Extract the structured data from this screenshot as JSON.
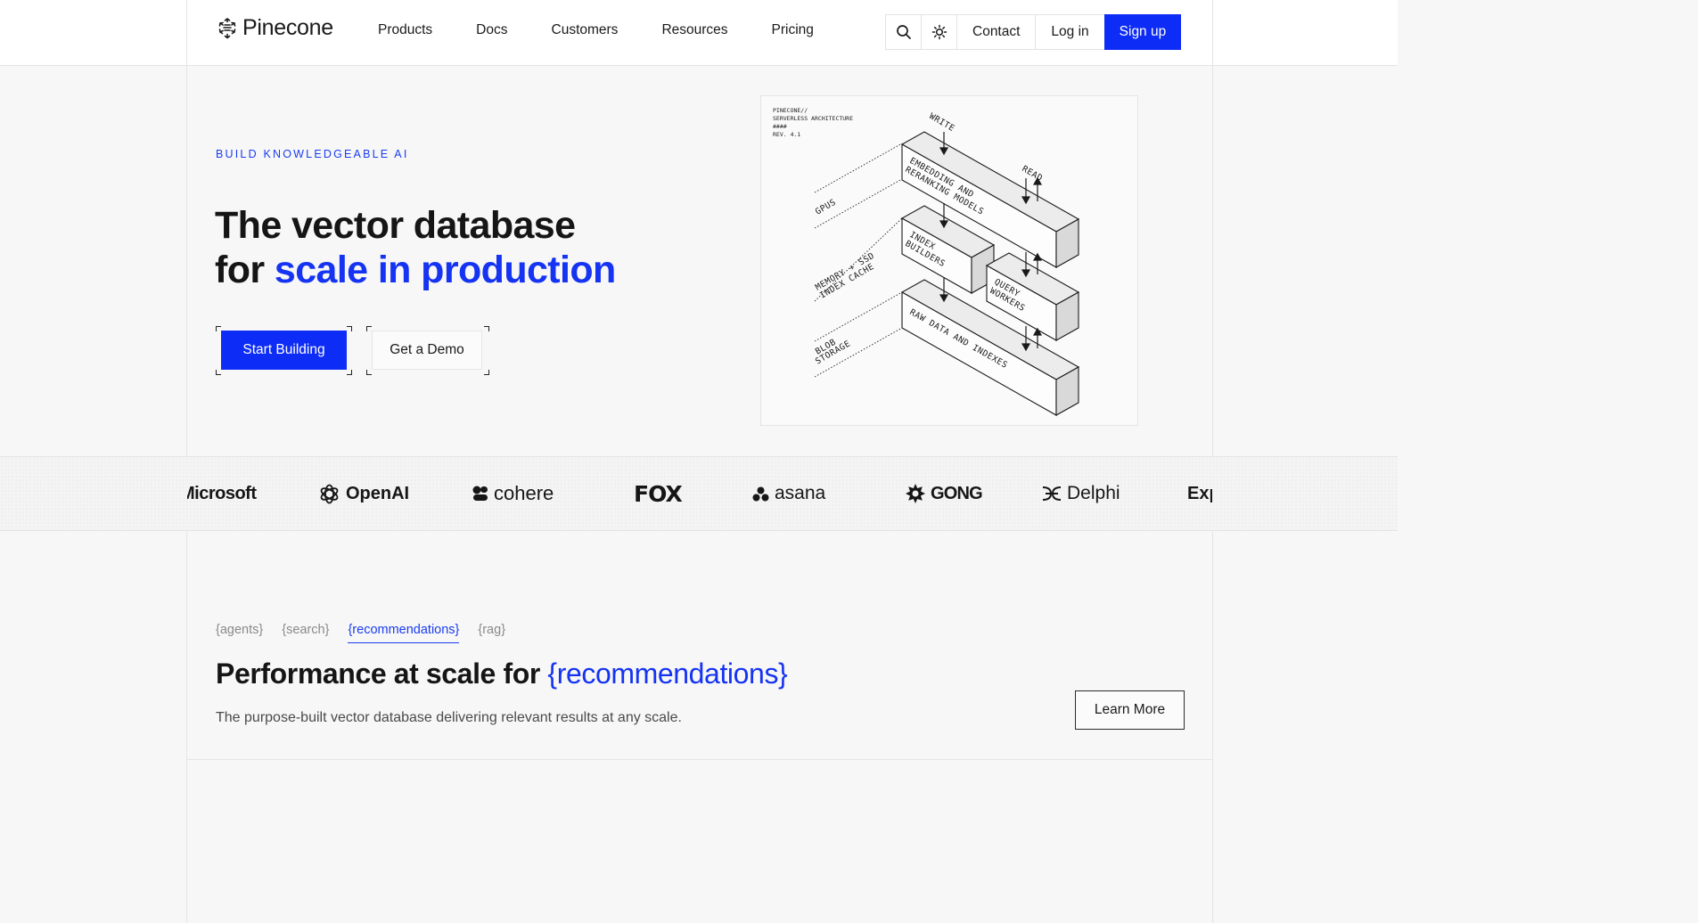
{
  "header": {
    "brand": "Pinecone",
    "nav": [
      {
        "label": "Products"
      },
      {
        "label": "Docs"
      },
      {
        "label": "Customers"
      },
      {
        "label": "Resources"
      },
      {
        "label": "Pricing"
      }
    ],
    "contact_label": "Contact",
    "login_label": "Log in",
    "signup_label": "Sign up"
  },
  "hero": {
    "eyebrow": "BUILD KNOWLEDGEABLE AI",
    "title_line1": "The vector database",
    "title_line2_prefix": "for ",
    "title_line2_accent": "scale in production",
    "start_label": "Start Building",
    "demo_label": "Get a Demo"
  },
  "diagram": {
    "header_lines": [
      "PINECONE//",
      "SERVERLESS ARCHITECTURE",
      "####",
      "REV. 4.1"
    ],
    "write": "WRITE",
    "read": "READ",
    "gpus": "GPUS",
    "memory_line1": "MEMORY + SSD",
    "memory_line2": "INDEX CACHE",
    "blob_line1": "BLOB",
    "blob_line2": "STORAGE",
    "embed_line1": "EMBEDDING AND",
    "embed_line2": "RERANKING MODELS",
    "index_line1": "INDEX",
    "index_line2": "BUILDERS",
    "query_line1": "QUERY",
    "query_line2": "WORKERS",
    "raw": "RAW DATA AND INDEXES"
  },
  "logos": [
    {
      "name": "Microsoft",
      "text": "Microsoft"
    },
    {
      "name": "OpenAI",
      "text": "OpenAI"
    },
    {
      "name": "cohere",
      "text": "cohere"
    },
    {
      "name": "FOX",
      "text": "FOX"
    },
    {
      "name": "asana",
      "text": "asana"
    },
    {
      "name": "GONG",
      "text": "GONG"
    },
    {
      "name": "Delphi",
      "text": "Delphi"
    },
    {
      "name": "Exp",
      "text": "Exp"
    }
  ],
  "usecases": {
    "tabs": [
      {
        "label": "{agents}"
      },
      {
        "label": "{search}"
      },
      {
        "label": "{recommendations}"
      },
      {
        "label": "{rag}"
      }
    ],
    "active_index": 2,
    "title_prefix": "Performance at scale for ",
    "title_accent": "{recommendations}",
    "subtitle": "The purpose-built vector database delivering relevant results at any scale.",
    "learn_more_label": "Learn More"
  },
  "colors": {
    "accent": "#0d2cf5",
    "text": "#1a1a1a",
    "background": "#f7f7f7"
  }
}
